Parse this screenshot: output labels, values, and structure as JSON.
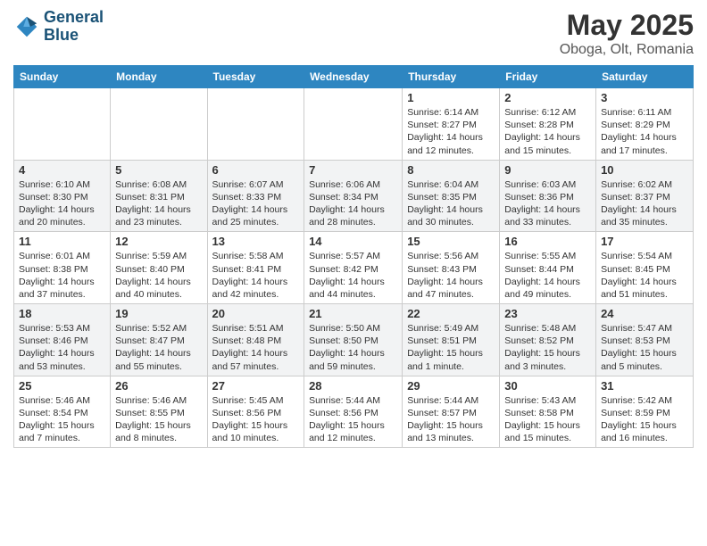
{
  "header": {
    "logo_line1": "General",
    "logo_line2": "Blue",
    "month_title": "May 2025",
    "location": "Oboga, Olt, Romania"
  },
  "weekdays": [
    "Sunday",
    "Monday",
    "Tuesday",
    "Wednesday",
    "Thursday",
    "Friday",
    "Saturday"
  ],
  "weeks": [
    [
      {
        "day": "",
        "info": ""
      },
      {
        "day": "",
        "info": ""
      },
      {
        "day": "",
        "info": ""
      },
      {
        "day": "",
        "info": ""
      },
      {
        "day": "1",
        "info": "Sunrise: 6:14 AM\nSunset: 8:27 PM\nDaylight: 14 hours\nand 12 minutes."
      },
      {
        "day": "2",
        "info": "Sunrise: 6:12 AM\nSunset: 8:28 PM\nDaylight: 14 hours\nand 15 minutes."
      },
      {
        "day": "3",
        "info": "Sunrise: 6:11 AM\nSunset: 8:29 PM\nDaylight: 14 hours\nand 17 minutes."
      }
    ],
    [
      {
        "day": "4",
        "info": "Sunrise: 6:10 AM\nSunset: 8:30 PM\nDaylight: 14 hours\nand 20 minutes."
      },
      {
        "day": "5",
        "info": "Sunrise: 6:08 AM\nSunset: 8:31 PM\nDaylight: 14 hours\nand 23 minutes."
      },
      {
        "day": "6",
        "info": "Sunrise: 6:07 AM\nSunset: 8:33 PM\nDaylight: 14 hours\nand 25 minutes."
      },
      {
        "day": "7",
        "info": "Sunrise: 6:06 AM\nSunset: 8:34 PM\nDaylight: 14 hours\nand 28 minutes."
      },
      {
        "day": "8",
        "info": "Sunrise: 6:04 AM\nSunset: 8:35 PM\nDaylight: 14 hours\nand 30 minutes."
      },
      {
        "day": "9",
        "info": "Sunrise: 6:03 AM\nSunset: 8:36 PM\nDaylight: 14 hours\nand 33 minutes."
      },
      {
        "day": "10",
        "info": "Sunrise: 6:02 AM\nSunset: 8:37 PM\nDaylight: 14 hours\nand 35 minutes."
      }
    ],
    [
      {
        "day": "11",
        "info": "Sunrise: 6:01 AM\nSunset: 8:38 PM\nDaylight: 14 hours\nand 37 minutes."
      },
      {
        "day": "12",
        "info": "Sunrise: 5:59 AM\nSunset: 8:40 PM\nDaylight: 14 hours\nand 40 minutes."
      },
      {
        "day": "13",
        "info": "Sunrise: 5:58 AM\nSunset: 8:41 PM\nDaylight: 14 hours\nand 42 minutes."
      },
      {
        "day": "14",
        "info": "Sunrise: 5:57 AM\nSunset: 8:42 PM\nDaylight: 14 hours\nand 44 minutes."
      },
      {
        "day": "15",
        "info": "Sunrise: 5:56 AM\nSunset: 8:43 PM\nDaylight: 14 hours\nand 47 minutes."
      },
      {
        "day": "16",
        "info": "Sunrise: 5:55 AM\nSunset: 8:44 PM\nDaylight: 14 hours\nand 49 minutes."
      },
      {
        "day": "17",
        "info": "Sunrise: 5:54 AM\nSunset: 8:45 PM\nDaylight: 14 hours\nand 51 minutes."
      }
    ],
    [
      {
        "day": "18",
        "info": "Sunrise: 5:53 AM\nSunset: 8:46 PM\nDaylight: 14 hours\nand 53 minutes."
      },
      {
        "day": "19",
        "info": "Sunrise: 5:52 AM\nSunset: 8:47 PM\nDaylight: 14 hours\nand 55 minutes."
      },
      {
        "day": "20",
        "info": "Sunrise: 5:51 AM\nSunset: 8:48 PM\nDaylight: 14 hours\nand 57 minutes."
      },
      {
        "day": "21",
        "info": "Sunrise: 5:50 AM\nSunset: 8:50 PM\nDaylight: 14 hours\nand 59 minutes."
      },
      {
        "day": "22",
        "info": "Sunrise: 5:49 AM\nSunset: 8:51 PM\nDaylight: 15 hours\nand 1 minute."
      },
      {
        "day": "23",
        "info": "Sunrise: 5:48 AM\nSunset: 8:52 PM\nDaylight: 15 hours\nand 3 minutes."
      },
      {
        "day": "24",
        "info": "Sunrise: 5:47 AM\nSunset: 8:53 PM\nDaylight: 15 hours\nand 5 minutes."
      }
    ],
    [
      {
        "day": "25",
        "info": "Sunrise: 5:46 AM\nSunset: 8:54 PM\nDaylight: 15 hours\nand 7 minutes."
      },
      {
        "day": "26",
        "info": "Sunrise: 5:46 AM\nSunset: 8:55 PM\nDaylight: 15 hours\nand 8 minutes."
      },
      {
        "day": "27",
        "info": "Sunrise: 5:45 AM\nSunset: 8:56 PM\nDaylight: 15 hours\nand 10 minutes."
      },
      {
        "day": "28",
        "info": "Sunrise: 5:44 AM\nSunset: 8:56 PM\nDaylight: 15 hours\nand 12 minutes."
      },
      {
        "day": "29",
        "info": "Sunrise: 5:44 AM\nSunset: 8:57 PM\nDaylight: 15 hours\nand 13 minutes."
      },
      {
        "day": "30",
        "info": "Sunrise: 5:43 AM\nSunset: 8:58 PM\nDaylight: 15 hours\nand 15 minutes."
      },
      {
        "day": "31",
        "info": "Sunrise: 5:42 AM\nSunset: 8:59 PM\nDaylight: 15 hours\nand 16 minutes."
      }
    ]
  ]
}
